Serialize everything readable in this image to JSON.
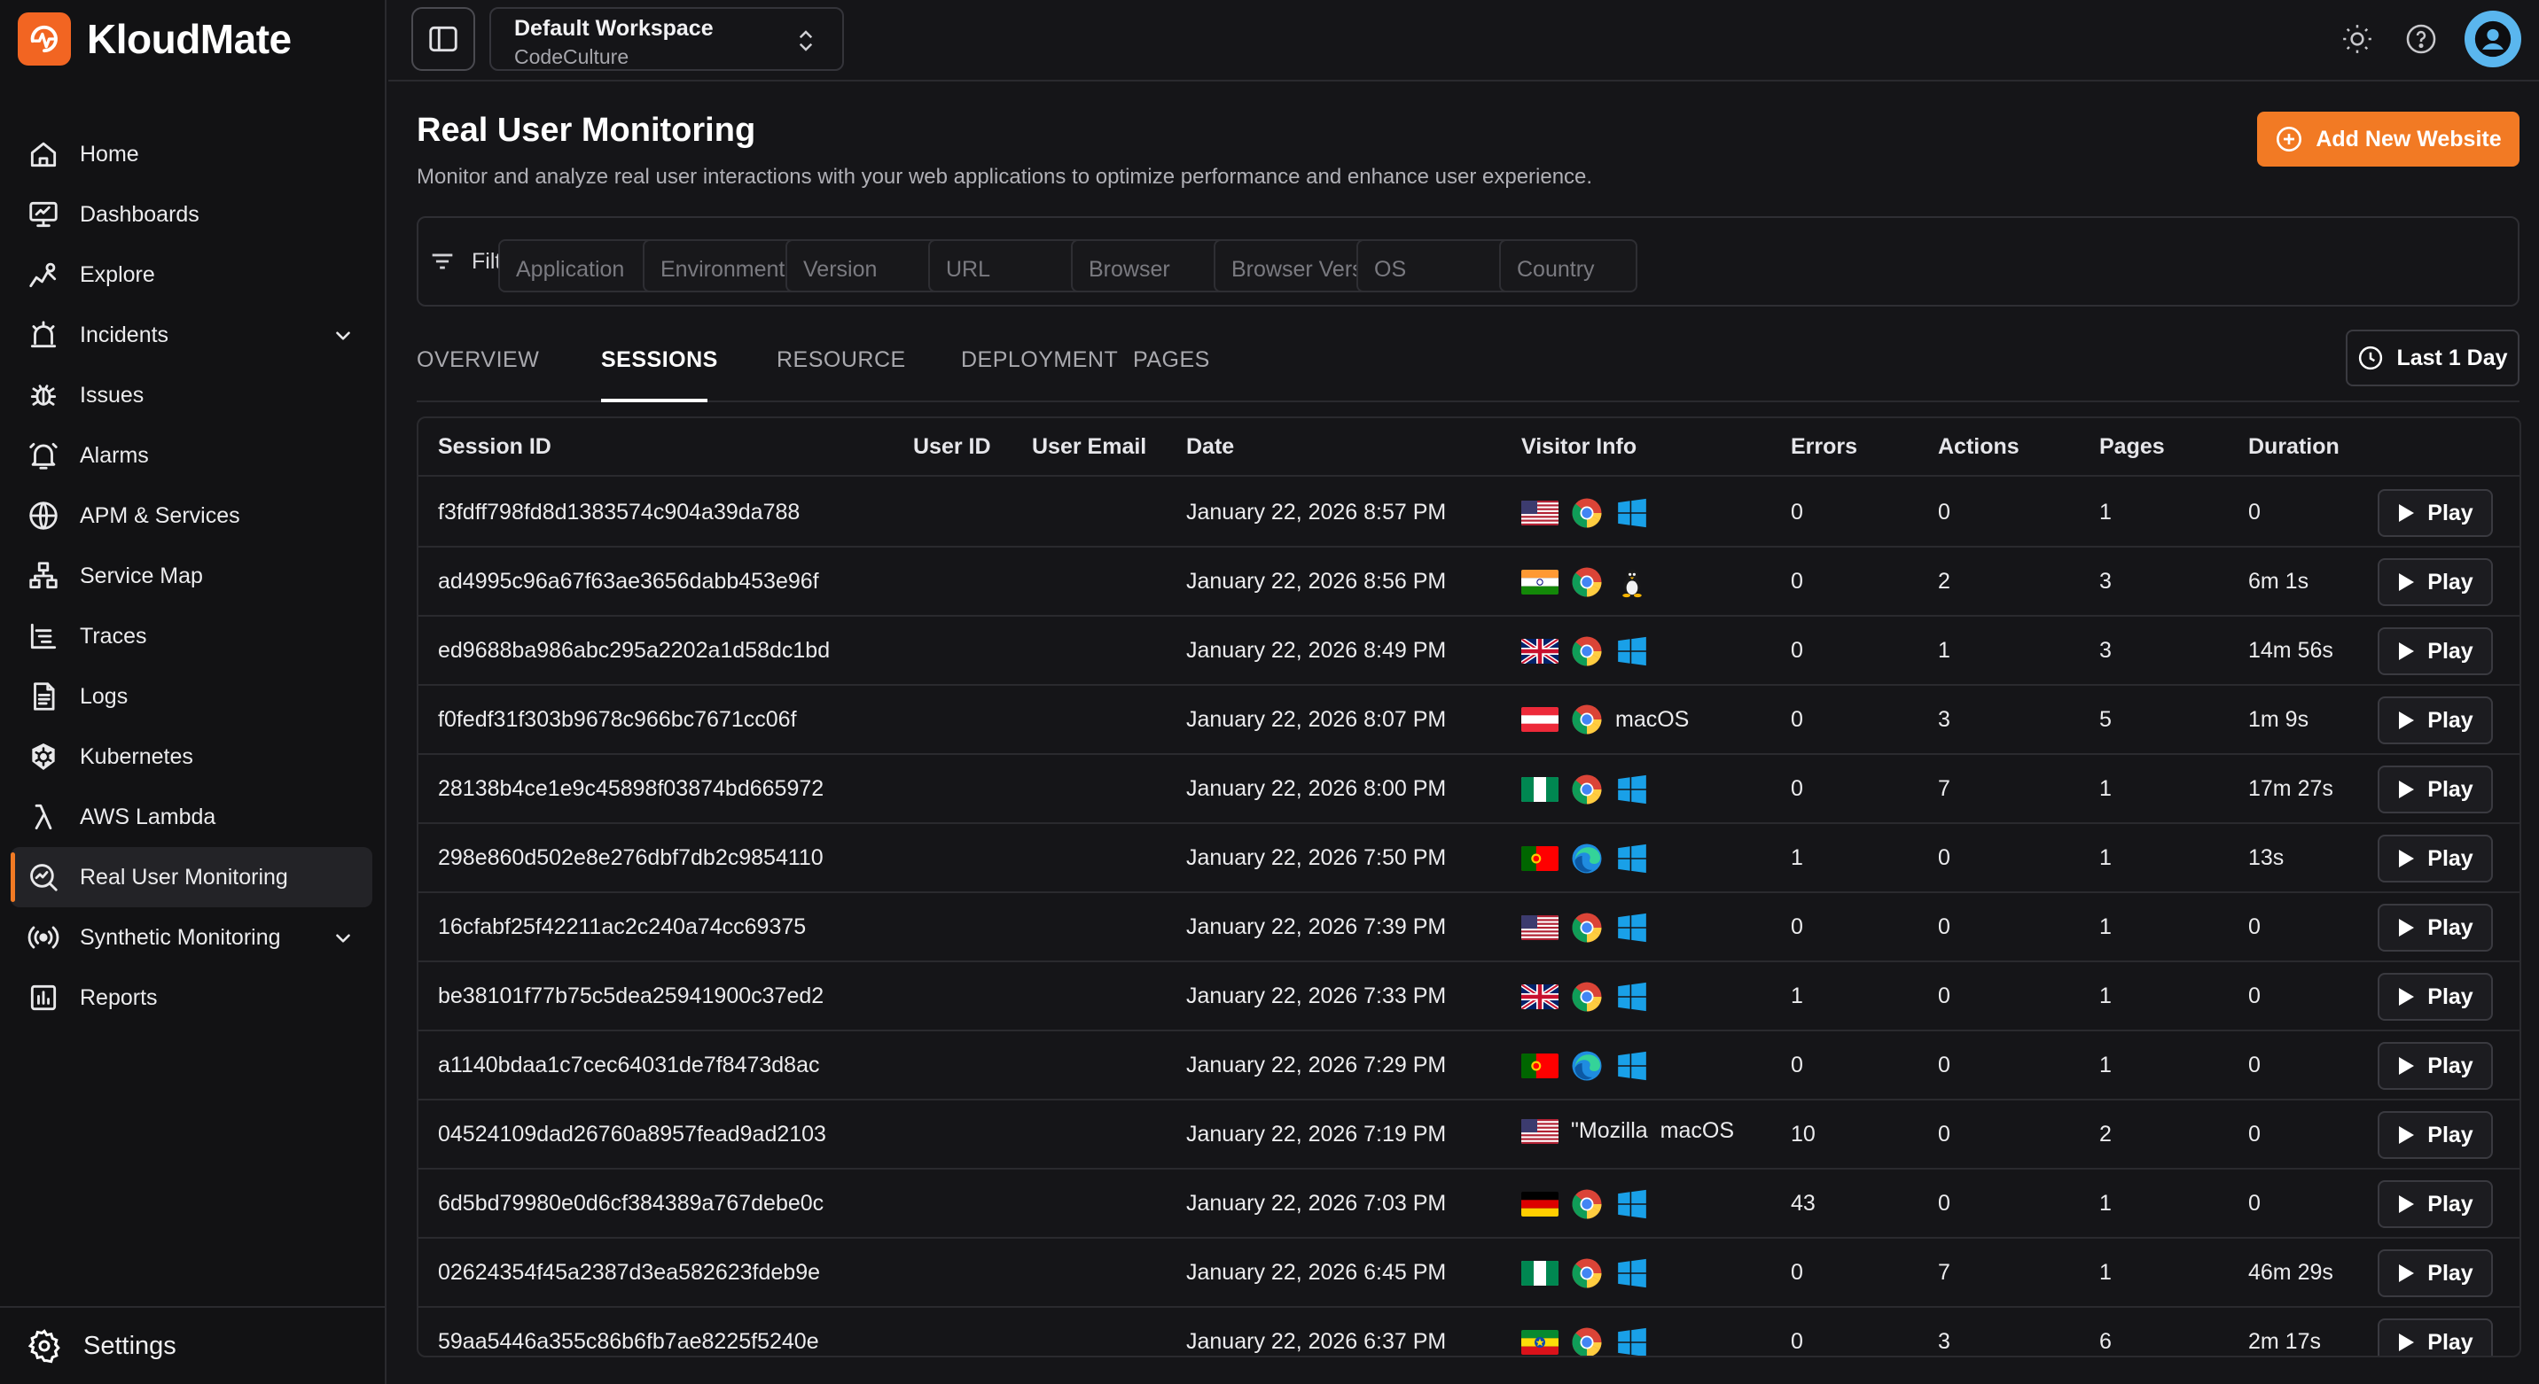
{
  "app": {
    "name": "KloudMate"
  },
  "sidebar": {
    "items": [
      {
        "label": "Home",
        "icon": "home-icon"
      },
      {
        "label": "Dashboards",
        "icon": "dashboard-icon"
      },
      {
        "label": "Explore",
        "icon": "explore-icon"
      },
      {
        "label": "Incidents",
        "icon": "incident-icon",
        "expandable": true
      },
      {
        "label": "Issues",
        "icon": "bug-icon"
      },
      {
        "label": "Alarms",
        "icon": "bell-icon"
      },
      {
        "label": "APM & Services",
        "icon": "globe-icon"
      },
      {
        "label": "Service Map",
        "icon": "service-map-icon"
      },
      {
        "label": "Traces",
        "icon": "traces-icon"
      },
      {
        "label": "Logs",
        "icon": "logs-icon"
      },
      {
        "label": "Kubernetes",
        "icon": "kubernetes-icon"
      },
      {
        "label": "AWS Lambda",
        "icon": "lambda-icon"
      },
      {
        "label": "Real User Monitoring",
        "icon": "rum-icon",
        "active": true
      },
      {
        "label": "Synthetic Monitoring",
        "icon": "broadcast-icon",
        "expandable": true
      },
      {
        "label": "Reports",
        "icon": "reports-icon"
      }
    ],
    "settings_label": "Settings"
  },
  "topbar": {
    "workspace_name": "Default Workspace",
    "workspace_org": "CodeCulture"
  },
  "page": {
    "title": "Real User Monitoring",
    "description": "Monitor and analyze real user interactions with your web applications to optimize performance and enhance user experience.",
    "add_button": "Add New Website",
    "accent_color": "#f27a24"
  },
  "filters": {
    "label": "Filters:",
    "placeholders": [
      "Application",
      "Environment",
      "Version",
      "URL",
      "Browser",
      "Browser Version",
      "OS",
      "Country"
    ]
  },
  "tabs": [
    "OVERVIEW",
    "SESSIONS",
    "RESOURCE",
    "DEPLOYMENT",
    "PAGES"
  ],
  "active_tab": "SESSIONS",
  "time_range": "Last 1 Day",
  "table": {
    "columns": [
      "Session ID",
      "User ID",
      "User Email",
      "Date",
      "Visitor Info",
      "Errors",
      "Actions",
      "Pages",
      "Duration"
    ],
    "play_label": "Play",
    "rows": [
      {
        "session_id": "f3fdff798fd8d1383574c904a39da788",
        "user_id": "",
        "user_email": "",
        "date": "January 22, 2026 8:57 PM",
        "flag": "us",
        "browser": "chrome",
        "os": "windows",
        "os_text": "",
        "errors": "0",
        "actions": "0",
        "pages": "1",
        "duration": "0"
      },
      {
        "session_id": "ad4995c96a67f63ae3656dabb453e96f",
        "user_id": "",
        "user_email": "",
        "date": "January 22, 2026 8:56 PM",
        "flag": "in",
        "browser": "chrome",
        "os": "linux",
        "os_text": "",
        "errors": "0",
        "actions": "2",
        "pages": "3",
        "duration": "6m 1s"
      },
      {
        "session_id": "ed9688ba986abc295a2202a1d58dc1bd",
        "user_id": "",
        "user_email": "",
        "date": "January 22, 2026 8:49 PM",
        "flag": "gb",
        "browser": "chrome",
        "os": "windows",
        "os_text": "",
        "errors": "0",
        "actions": "1",
        "pages": "3",
        "duration": "14m 56s"
      },
      {
        "session_id": "f0fedf31f303b9678c966bc7671cc06f",
        "user_id": "",
        "user_email": "",
        "date": "January 22, 2026 8:07 PM",
        "flag": "at",
        "browser": "chrome",
        "os": "text",
        "os_text": "macOS",
        "errors": "0",
        "actions": "3",
        "pages": "5",
        "duration": "1m 9s"
      },
      {
        "session_id": "28138b4ce1e9c45898f03874bd665972",
        "user_id": "",
        "user_email": "",
        "date": "January 22, 2026 8:00 PM",
        "flag": "ng",
        "browser": "chrome",
        "os": "windows",
        "os_text": "",
        "errors": "0",
        "actions": "7",
        "pages": "1",
        "duration": "17m 27s"
      },
      {
        "session_id": "298e860d502e8e276dbf7db2c9854110",
        "user_id": "",
        "user_email": "",
        "date": "January 22, 2026 7:50 PM",
        "flag": "pt",
        "browser": "edge",
        "os": "windows",
        "os_text": "",
        "errors": "1",
        "actions": "0",
        "pages": "1",
        "duration": "13s"
      },
      {
        "session_id": "16cfabf25f42211ac2c240a74cc69375",
        "user_id": "",
        "user_email": "",
        "date": "January 22, 2026 7:39 PM",
        "flag": "us",
        "browser": "chrome",
        "os": "windows",
        "os_text": "",
        "errors": "0",
        "actions": "0",
        "pages": "1",
        "duration": "0"
      },
      {
        "session_id": "be38101f77b75c5dea25941900c37ed2",
        "user_id": "",
        "user_email": "",
        "date": "January 22, 2026 7:33 PM",
        "flag": "gb",
        "browser": "chrome",
        "os": "windows",
        "os_text": "",
        "errors": "1",
        "actions": "0",
        "pages": "1",
        "duration": "0"
      },
      {
        "session_id": "a1140bdaa1c7cec64031de7f8473d8ac",
        "user_id": "",
        "user_email": "",
        "date": "January 22, 2026 7:29 PM",
        "flag": "pt",
        "browser": "edge",
        "os": "windows",
        "os_text": "",
        "errors": "0",
        "actions": "0",
        "pages": "1",
        "duration": "0"
      },
      {
        "session_id": "04524109dad26760a8957fead9ad2103",
        "user_id": "",
        "user_email": "",
        "date": "January 22, 2026 7:19 PM",
        "flag": "us",
        "browser": "text",
        "browser_text": "\"Mozilla",
        "os": "text",
        "os_text": "macOS",
        "errors": "10",
        "actions": "0",
        "pages": "2",
        "duration": "0"
      },
      {
        "session_id": "6d5bd79980e0d6cf384389a767debe0c",
        "user_id": "",
        "user_email": "",
        "date": "January 22, 2026 7:03 PM",
        "flag": "de",
        "browser": "chrome",
        "os": "windows",
        "os_text": "",
        "errors": "43",
        "actions": "0",
        "pages": "1",
        "duration": "0"
      },
      {
        "session_id": "02624354f45a2387d3ea582623fdeb9e",
        "user_id": "",
        "user_email": "",
        "date": "January 22, 2026 6:45 PM",
        "flag": "ng",
        "browser": "chrome",
        "os": "windows",
        "os_text": "",
        "errors": "0",
        "actions": "7",
        "pages": "1",
        "duration": "46m 29s"
      },
      {
        "session_id": "59aa5446a355c86b6fb7ae8225f5240e",
        "user_id": "",
        "user_email": "",
        "date": "January 22, 2026 6:37 PM",
        "flag": "et",
        "browser": "chrome",
        "os": "windows",
        "os_text": "",
        "errors": "0",
        "actions": "3",
        "pages": "6",
        "duration": "2m 17s"
      }
    ]
  }
}
